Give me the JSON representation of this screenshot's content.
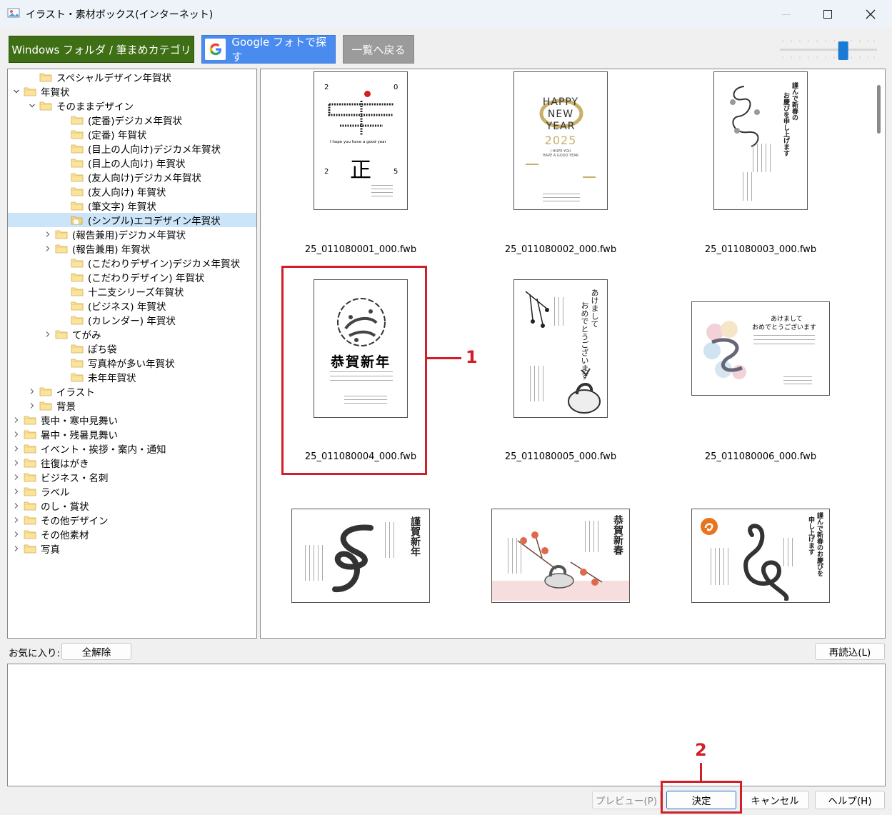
{
  "window": {
    "title": "イラスト・素材ボックス(インターネット)"
  },
  "toolbar": {
    "windows_label": "Windows フォルダ / 筆まめカテゴリ",
    "google_label": "Google フォトで探す",
    "back_label": "一覧へ戻る",
    "zoom_level": 0.67
  },
  "tree": {
    "items": [
      {
        "label": "スペシャルデザイン年賀状",
        "level": 1,
        "expander": "none"
      },
      {
        "label": "年賀状",
        "level": 0,
        "expander": "expanded"
      },
      {
        "label": "そのままデザイン",
        "level": 1,
        "expander": "expanded"
      },
      {
        "label": "(定番)デジカメ年賀状",
        "level": 3,
        "expander": "none"
      },
      {
        "label": "(定番) 年賀状",
        "level": 3,
        "expander": "none"
      },
      {
        "label": "(目上の人向け)デジカメ年賀状",
        "level": 3,
        "expander": "none"
      },
      {
        "label": "(目上の人向け) 年賀状",
        "level": 3,
        "expander": "none"
      },
      {
        "label": "(友人向け)デジカメ年賀状",
        "level": 3,
        "expander": "none"
      },
      {
        "label": "(友人向け) 年賀状",
        "level": 3,
        "expander": "none"
      },
      {
        "label": "(筆文字) 年賀状",
        "level": 3,
        "expander": "none"
      },
      {
        "label": "(シンプル)エコデザイン年賀状",
        "level": 3,
        "expander": "none",
        "selected": true
      },
      {
        "label": "(報告兼用)デジカメ年賀状",
        "level": 2,
        "expander": "collapsed"
      },
      {
        "label": "(報告兼用) 年賀状",
        "level": 2,
        "expander": "collapsed"
      },
      {
        "label": "(こだわりデザイン)デジカメ年賀状",
        "level": 3,
        "expander": "none"
      },
      {
        "label": "(こだわりデザイン) 年賀状",
        "level": 3,
        "expander": "none"
      },
      {
        "label": "十二支シリーズ年賀状",
        "level": 3,
        "expander": "none"
      },
      {
        "label": "(ビジネス) 年賀状",
        "level": 3,
        "expander": "none"
      },
      {
        "label": "(カレンダー) 年賀状",
        "level": 3,
        "expander": "none"
      },
      {
        "label": "てがみ",
        "level": 2,
        "expander": "collapsed"
      },
      {
        "label": "ぽち袋",
        "level": 3,
        "expander": "none"
      },
      {
        "label": "写真枠が多い年賀状",
        "level": 3,
        "expander": "none"
      },
      {
        "label": "未年年賀状",
        "level": 3,
        "expander": "none"
      },
      {
        "label": "イラスト",
        "level": 1,
        "expander": "collapsed"
      },
      {
        "label": "背景",
        "level": 1,
        "expander": "collapsed"
      },
      {
        "label": "喪中・寒中見舞い",
        "level": 0,
        "expander": "collapsed"
      },
      {
        "label": "暑中・残暑見舞い",
        "level": 0,
        "expander": "collapsed"
      },
      {
        "label": "イベント・挨拶・案内・通知",
        "level": 0,
        "expander": "collapsed"
      },
      {
        "label": "往復はがき",
        "level": 0,
        "expander": "collapsed"
      },
      {
        "label": "ビジネス・名刺",
        "level": 0,
        "expander": "collapsed"
      },
      {
        "label": "ラベル",
        "level": 0,
        "expander": "collapsed"
      },
      {
        "label": "のし・賞状",
        "level": 0,
        "expander": "collapsed"
      },
      {
        "label": "その他デザイン",
        "level": 0,
        "expander": "collapsed"
      },
      {
        "label": "その他素材",
        "level": 0,
        "expander": "collapsed"
      },
      {
        "label": "写真",
        "level": 0,
        "expander": "collapsed"
      }
    ]
  },
  "grid": {
    "items": [
      {
        "filename": "25_011080001_000.fwb",
        "orientation": "portrait",
        "art": {
          "top_left": "2",
          "top_right": "0",
          "bottom_left": "2",
          "bottom_right": "5",
          "tagline": "I hope you have a good year",
          "glyph": "正"
        }
      },
      {
        "filename": "25_011080002_000.fwb",
        "orientation": "portrait",
        "art": {
          "line1": "HAPPY",
          "line2": "NEW",
          "line3": "YEAR",
          "year": "2025",
          "sub1": "I HOPE YOU",
          "sub2": "HAVE A GOOD YEAR"
        }
      },
      {
        "filename": "25_011080003_000.fwb",
        "orientation": "portrait",
        "art": {
          "col1": "謹んで新春の",
          "col2": "お慶びを申し上げます"
        }
      },
      {
        "filename": "25_011080004_000.fwb",
        "orientation": "portrait",
        "art": {
          "headline": "恭賀新年"
        }
      },
      {
        "filename": "25_011080005_000.fwb",
        "orientation": "portrait",
        "art": {
          "col1": "あけまして",
          "col2": "おめでとうございます"
        }
      },
      {
        "filename": "25_011080006_000.fwb",
        "orientation": "landscape",
        "art": {
          "line1": "あけまして",
          "line2": "おめでとうございます"
        }
      },
      {
        "filename": "",
        "orientation": "landscape",
        "art": {
          "col1": "謹賀新年"
        }
      },
      {
        "filename": "",
        "orientation": "landscape",
        "art": {
          "col1": "恭賀新春"
        }
      },
      {
        "filename": "",
        "orientation": "landscape",
        "art": {
          "col1": "謹んで新春のお慶びを",
          "col2": "申し上げます"
        }
      }
    ]
  },
  "favorites": {
    "label": "お気に入り:",
    "clear_all": "全解除",
    "reload": "再読込(L)"
  },
  "footer": {
    "preview": "プレビュー(P)",
    "ok": "決定",
    "cancel": "キャンセル",
    "help": "ヘルプ(H)"
  },
  "annotations": {
    "step1": "1",
    "step2": "2"
  },
  "colors": {
    "windows_button": "#3f6f15",
    "google_button": "#4a8bf0",
    "back_button": "#9b9b9b",
    "annotation_red": "#d21e28",
    "selection": "#cce4f7"
  }
}
